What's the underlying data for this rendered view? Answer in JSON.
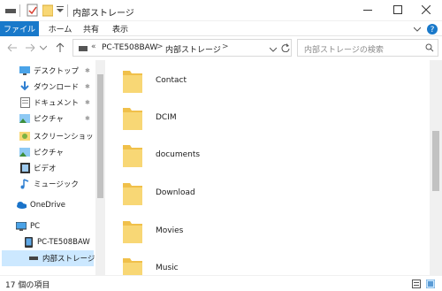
{
  "window": {
    "title": "内部ストレージ"
  },
  "ribbon": {
    "tabs": [
      "ファイル",
      "ホーム",
      "共有",
      "表示"
    ]
  },
  "address": {
    "prefix": "«",
    "parts": [
      "PC-TE508BAW",
      "内部ストレージ"
    ],
    "separator": ">"
  },
  "search": {
    "placeholder": "内部ストレージの検索"
  },
  "nav": {
    "items": [
      {
        "label": "デスクトップ",
        "icon": "desktop-icon",
        "pinned": true
      },
      {
        "label": "ダウンロード",
        "icon": "download-icon",
        "pinned": true
      },
      {
        "label": "ドキュメント",
        "icon": "documents-icon",
        "pinned": true
      },
      {
        "label": "ピクチャ",
        "icon": "pictures-icon",
        "pinned": true
      },
      {
        "label": "スクリーンショット",
        "icon": "screenshot-folder-icon",
        "pinned": false
      },
      {
        "label": "ピクチャ",
        "icon": "pictures-folder-icon",
        "pinned": false
      },
      {
        "label": "ビデオ",
        "icon": "video-icon",
        "pinned": false
      },
      {
        "label": "ミュージック",
        "icon": "music-icon",
        "pinned": false
      },
      {
        "label": "OneDrive",
        "icon": "onedrive-icon",
        "pinned": false
      },
      {
        "label": "PC",
        "icon": "pc-icon",
        "pinned": false
      },
      {
        "label": "PC-TE508BAW",
        "icon": "device-icon",
        "pinned": false
      },
      {
        "label": "内部ストレージ",
        "icon": "storage-icon",
        "pinned": false,
        "selected": true
      }
    ]
  },
  "files": [
    {
      "name": "Contact"
    },
    {
      "name": "DCIM"
    },
    {
      "name": "documents"
    },
    {
      "name": "Download"
    },
    {
      "name": "Movies"
    },
    {
      "name": "Music"
    }
  ],
  "status": {
    "item_count": "17 個の項目"
  },
  "colors": {
    "accent": "#1979ca",
    "selected": "#cce8ff",
    "folder": "#f8d775"
  }
}
